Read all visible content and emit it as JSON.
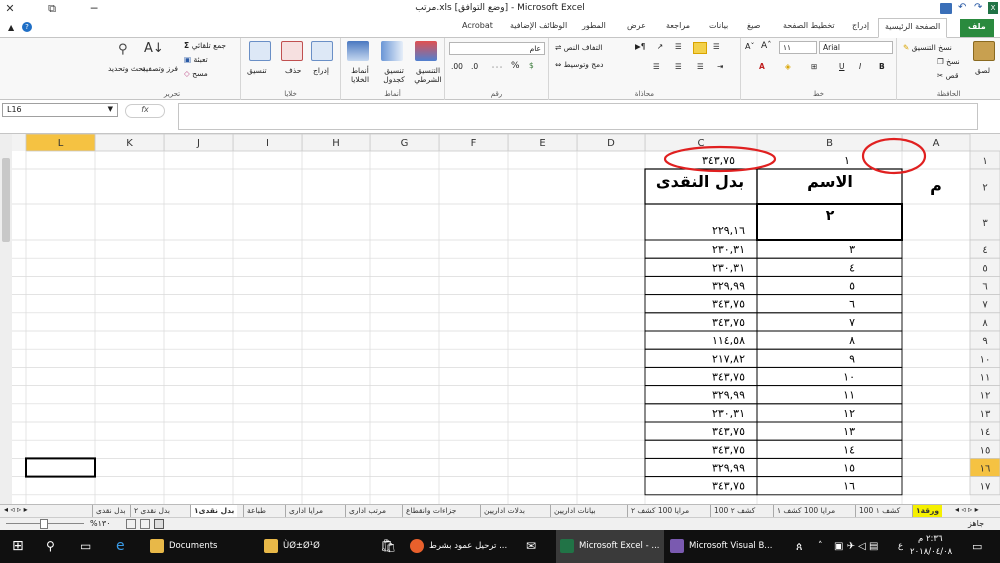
{
  "window": {
    "title": "مرتب.xls  [وضع التوافق] - Microsoft Excel",
    "controls": {
      "close": "✕",
      "restore": "⧉",
      "minimize": "─"
    }
  },
  "quick_access": {
    "icons": [
      "save-icon",
      "undo-icon",
      "redo-icon"
    ]
  },
  "ribbon_tabs": [
    {
      "label": "ملف",
      "type": "file"
    },
    {
      "label": "الصفحة الرئيسية",
      "type": "active"
    },
    {
      "label": "إدراج"
    },
    {
      "label": "تخطيط الصفحة"
    },
    {
      "label": "صيغ"
    },
    {
      "label": "بيانات"
    },
    {
      "label": "مراجعة"
    },
    {
      "label": "عرض"
    },
    {
      "label": "المطور"
    },
    {
      "label": "الوظائف الإضافية"
    },
    {
      "label": "Acrobat"
    }
  ],
  "ribbon": {
    "clipboard": {
      "label": "الحافظة",
      "paste": "لصق",
      "cut": "قص",
      "copy": "نسخ",
      "format_painter": "نسخ التنسيق"
    },
    "font": {
      "label": "خط",
      "font_name": "Arial",
      "font_size": "١١",
      "bold": "B",
      "italic": "I",
      "underline": "U"
    },
    "alignment": {
      "label": "محاذاة",
      "wrap": "التفاف النص",
      "merge": "دمج وتوسيط"
    },
    "number": {
      "label": "رقم",
      "format": "عام",
      "percent": "%",
      "comma": "٠٠٠",
      "inc": ".00",
      "dec": ".0"
    },
    "styles": {
      "label": "أنماط",
      "conditional": "التنسيق الشرطي",
      "as_table": "تنسيق كجدول",
      "cell_styles": "أنماط الخلايا"
    },
    "cells": {
      "label": "خلايا",
      "insert": "إدراج",
      "delete": "حذف",
      "format": "تنسيق"
    },
    "editing": {
      "label": "تحرير",
      "autosum": "جمع تلقائي",
      "fill": "تعبئة",
      "clear": "مسح",
      "sort": "فرز وتصفية",
      "find": "بحث وتحديد"
    }
  },
  "formula_bar": {
    "name_box": "L16",
    "fx": "fx",
    "content": ""
  },
  "columns": [
    "A",
    "B",
    "C",
    "D",
    "E",
    "F",
    "G",
    "H",
    "I",
    "J",
    "K",
    "L"
  ],
  "rows": [
    "١",
    "٢",
    "٣",
    "٤",
    "٥",
    "٦",
    "٧",
    "٨",
    "٩",
    "١٠",
    "١١",
    "١٢",
    "١٣",
    "١٤",
    "١٥",
    "١٦",
    "١٧"
  ],
  "cells": {
    "A1": "",
    "B1": "١",
    "C1": "٣٤٣,٧٥",
    "A2": "م",
    "B2": "الاسم",
    "C2": "بدل النقدى",
    "B3": "٢",
    "C3": "٢٢٩,١٦",
    "table": [
      {
        "b": "٣",
        "c": "٢٣٠,٣١"
      },
      {
        "b": "٤",
        "c": "٢٣٠,٣١"
      },
      {
        "b": "٥",
        "c": "٣٢٩,٩٩"
      },
      {
        "b": "٦",
        "c": "٣٤٣,٧٥"
      },
      {
        "b": "٧",
        "c": "٣٤٣,٧٥"
      },
      {
        "b": "٨",
        "c": "١١٤,٥٨"
      },
      {
        "b": "٩",
        "c": "٢١٧,٨٢"
      },
      {
        "b": "١٠",
        "c": "٣٤٣,٧٥"
      },
      {
        "b": "١١",
        "c": "٣٢٩,٩٩"
      },
      {
        "b": "١٢",
        "c": "٢٣٠,٣١"
      },
      {
        "b": "١٣",
        "c": "٣٤٣,٧٥"
      },
      {
        "b": "١٤",
        "c": "٣٤٣,٧٥"
      },
      {
        "b": "١٥",
        "c": "٣٢٩,٩٩"
      },
      {
        "b": "١٦",
        "c": "٣٤٣,٧٥"
      }
    ]
  },
  "sheet_tabs": [
    "ورقة١",
    "100 كشف ١",
    "مرايا 100 كشف ١",
    "100 كشف ٢",
    "مرايا 100 كشف ٢",
    "بيانات اداريين",
    "بدلات اداريين",
    "جزاءات وانقطاع",
    "مرتب ادارى",
    "مرايا ادارى",
    "طباعة",
    "بدل نقدى١",
    "بدل نقدى ٢",
    "بدل نقدى"
  ],
  "active_sheet": "بدل نقدى١",
  "status_bar": {
    "ready": "جاهز",
    "zoom": "%١٣٠"
  },
  "taskbar": {
    "items": [
      "Documents",
      "ÙØ±Ø¹Ø",
      "ترحيل عمود بشرط ...",
      "Microsoft Excel - ...",
      "Microsoft Visual B..."
    ],
    "time": "٢:٣٦ م",
    "date": "٢٠١٨/٠٤/٠٨",
    "lang": "ع"
  },
  "colors": {
    "excel_green": "#217346",
    "file_tab": "#2a8a3e",
    "annotation_red": "#e02020",
    "selected_row_header": "#f5c242"
  }
}
